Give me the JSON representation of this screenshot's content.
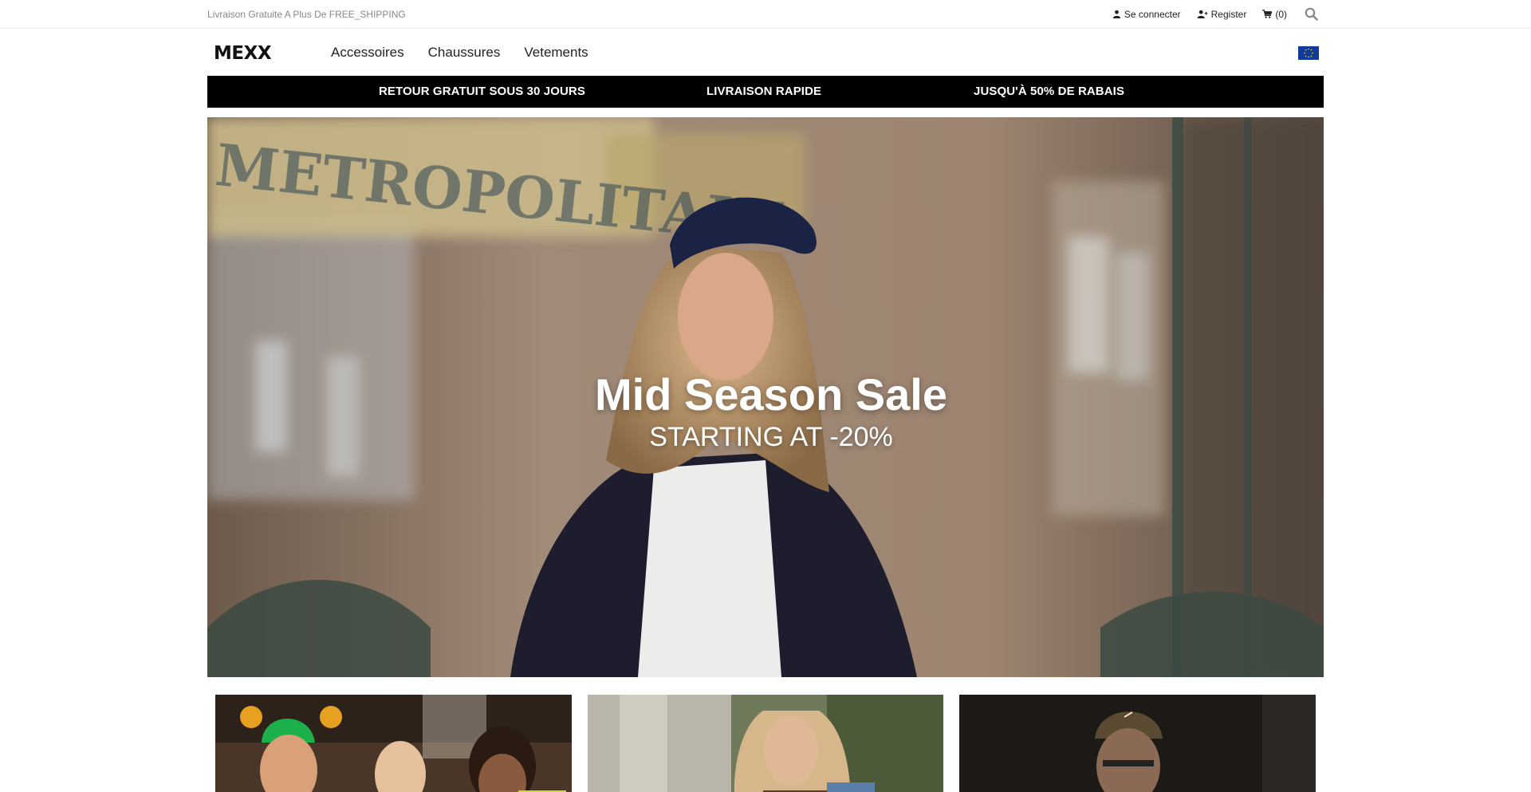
{
  "topbar": {
    "shipping_note": "Livraison Gratuite A Plus De FREE_SHIPPING",
    "login_label": "Se connecter",
    "login_icon": "user-icon",
    "register_label": "Register",
    "register_icon": "user-plus-icon",
    "cart_label": "(0)",
    "cart_icon": "cart-icon",
    "search_icon": "search-icon"
  },
  "header": {
    "logo_text": "MEXX",
    "nav": [
      {
        "label": "Accessoires"
      },
      {
        "label": "Chaussures"
      },
      {
        "label": "Vetements"
      }
    ],
    "region_flag": "eu-flag-icon"
  },
  "promo": {
    "items": [
      {
        "label": "RETOUR GRATUIT SOUS 30 JOURS"
      },
      {
        "label": "LIVRAISON RAPIDE"
      },
      {
        "label": "JUSQU'À 50% DE RABAIS"
      }
    ]
  },
  "hero": {
    "sign_text": "METROPOLITAIN",
    "title": "Mid Season Sale",
    "subtitle": "STARTING AT -20%"
  },
  "colors": {
    "promo_bg": "#000000",
    "flag_blue": "#103b9b",
    "flag_stars": "#ffdd00"
  }
}
